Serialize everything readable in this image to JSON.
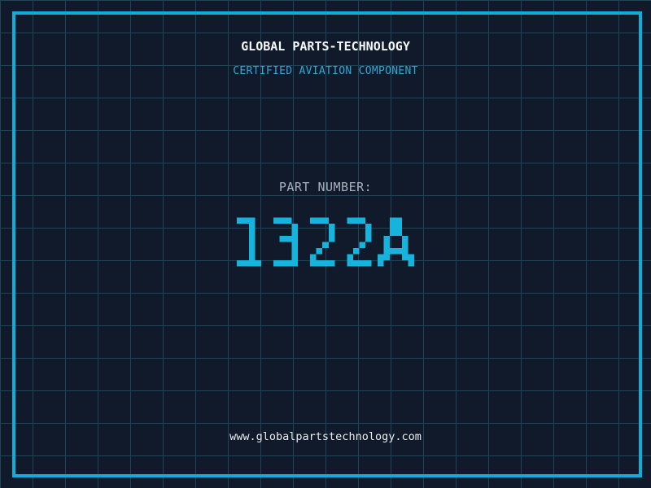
{
  "brand": {
    "title": "GLOBAL PARTS-TECHNOLOGY",
    "subtitle": "CERTIFIED AVIATION COMPONENT"
  },
  "part": {
    "label": "PART NUMBER:",
    "number": "1322A"
  },
  "footer": {
    "website": "www.globalpartstechnology.com"
  },
  "colors": {
    "background": "#101a2a",
    "grid": "#1c4557",
    "border": "#10aed6",
    "title": "#f5f8fa",
    "subtitle": "#2fa9d4",
    "label": "#a8b1bc",
    "number": "#16b3dc",
    "website": "#e9edf1"
  }
}
